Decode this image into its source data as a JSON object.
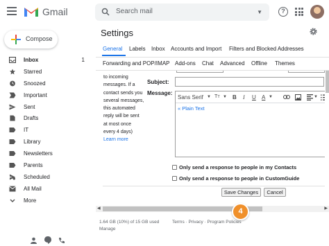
{
  "app": {
    "brand": "Gmail",
    "accent": "#1a73e8",
    "badge_color": "#f0902b"
  },
  "search": {
    "placeholder": "Search mail"
  },
  "compose": {
    "label": "Compose"
  },
  "sidebar": {
    "items": [
      {
        "label": "Inbox",
        "count": "1",
        "icon": "inbox-icon",
        "active": true
      },
      {
        "label": "Starred",
        "icon": "star-icon"
      },
      {
        "label": "Snoozed",
        "icon": "clock-icon"
      },
      {
        "label": "Important",
        "icon": "important-icon"
      },
      {
        "label": "Sent",
        "icon": "send-icon"
      },
      {
        "label": "Drafts",
        "icon": "draft-icon"
      },
      {
        "label": "IT",
        "icon": "label-icon"
      },
      {
        "label": "Library",
        "icon": "label-icon"
      },
      {
        "label": "Newsletters",
        "icon": "label-icon"
      },
      {
        "label": "Parents",
        "icon": "label-icon"
      },
      {
        "label": "Scheduled",
        "icon": "scheduled-icon"
      },
      {
        "label": "All Mail",
        "icon": "all-mail-icon"
      },
      {
        "label": "More",
        "icon": "chevron-down-icon"
      }
    ]
  },
  "settings": {
    "title": "Settings",
    "tabs_row1": [
      "General",
      "Labels",
      "Inbox",
      "Accounts and Import",
      "Filters and Blocked Addresses"
    ],
    "tabs_row2": [
      "Forwarding and POP/IMAP",
      "Add-ons",
      "Chat",
      "Advanced",
      "Offline",
      "Themes"
    ],
    "active_tab": "General"
  },
  "vacation": {
    "description": [
      "to incoming",
      "messages. If a",
      "contact sends you",
      "several messages,",
      "this automated",
      "reply will be sent",
      "at most once",
      "every 4 days)"
    ],
    "learn_more": "Learn more",
    "subject_label": "Subject:",
    "subject_value": "",
    "message_label": "Message:",
    "font_name": "Sans Serif",
    "plain_text_link": "« Plain Text",
    "contacts_only_label": "Only send a response to people in my Contacts",
    "org_only_label": "Only send a response to people in CustomGuide",
    "save_label": "Save Changes",
    "cancel_label": "Cancel"
  },
  "footer": {
    "storage": "1.64 GB (10%) of 15 GB used",
    "manage": "Manage",
    "links": "Terms · Privacy · Program Policies"
  },
  "step_badge": "4"
}
